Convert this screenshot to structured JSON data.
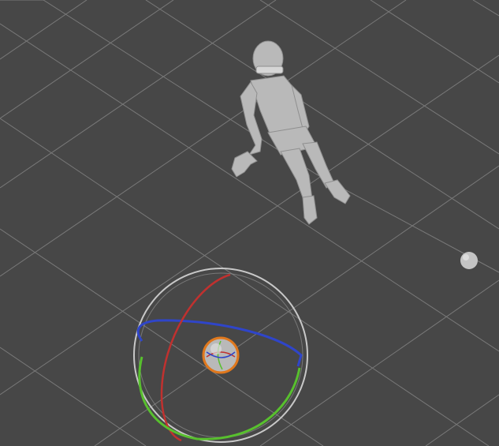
{
  "scene_view": {
    "background_color": "#474747",
    "grid_color": "#8a8a8a",
    "character_color": "#b9b9b9",
    "character_shadow_color": "#8f8f8f",
    "light_sphere_color": "#c4c4c4"
  },
  "rotation_gizmo": {
    "active": true,
    "outer_ring_color": "#c8c8c8",
    "x_axis_color": "#c0312f",
    "y_axis_color": "#58c02e",
    "z_axis_color": "#2f45c9",
    "selection_ring_color": "#e0781d"
  }
}
